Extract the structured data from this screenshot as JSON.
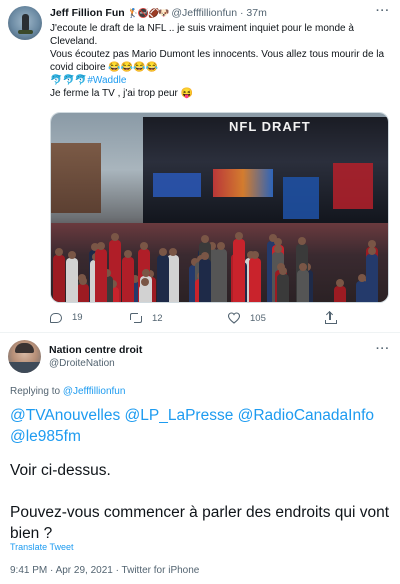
{
  "tweet": {
    "author_name": "Jeff Fillion Fun",
    "author_emojis": "🏌️🚭🏈🐶",
    "author_handle": "@Jefffillionfun",
    "time": "· 37m",
    "more_label": "···",
    "lines": [
      "J'ecoute le draft de la NFL .. je suis vraiment inquiet pour le monde à Cleveland.",
      "Vous écoutez pas Mario Dumont les innocents. Vous allez tous mourir de la covid ciboire 😂😂😂😂",
      "Je ferme la TV , j'ai trop peur 😝"
    ],
    "hashtag_prefix": "🐬🐬🐬",
    "hashtag": "#Waddle",
    "media_sign": "NFL DRAFT",
    "stats": {
      "replies": "19",
      "retweets": "12",
      "likes": "105"
    }
  },
  "reply": {
    "author_name": "Nation centre droit",
    "author_handle": "@DroiteNation",
    "more_label": "···",
    "replying_prefix": "Replying to ",
    "replying_to": "@Jefffillionfun",
    "mentions": "@TVAnouvelles @LP_LaPresse @RadioCanadaInfo @le985fm",
    "paragraph1": "Voir ci-dessus.",
    "paragraph2": "Pouvez-vous commencer à parler des endroits qui vont bien ?",
    "translate_label": "Translate Tweet",
    "meta": "9:41 PM · Apr 29, 2021 · Twitter for iPhone"
  },
  "colors": {
    "link": "#1d9bf0",
    "secondary": "#536471",
    "text": "#0f1419"
  }
}
